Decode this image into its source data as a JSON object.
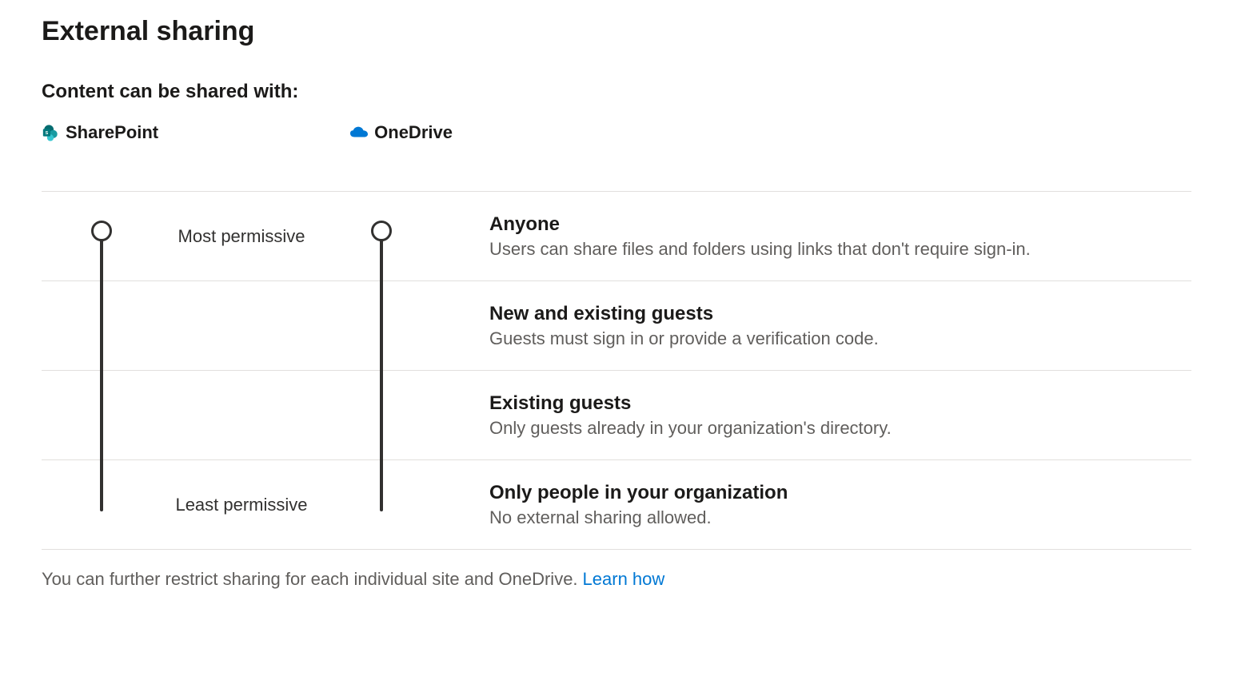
{
  "page": {
    "title": "External sharing",
    "subtitle": "Content can be shared with:"
  },
  "services": [
    {
      "name": "SharePoint",
      "icon": "sharepoint"
    },
    {
      "name": "OneDrive",
      "icon": "onedrive"
    }
  ],
  "slider": {
    "topLabel": "Most permissive",
    "bottomLabel": "Least permissive",
    "levels": [
      {
        "title": "Anyone",
        "description": "Users can share files and folders using links that don't require sign-in."
      },
      {
        "title": "New and existing guests",
        "description": "Guests must sign in or provide a verification code."
      },
      {
        "title": "Existing guests",
        "description": "Only guests already in your organization's directory."
      },
      {
        "title": "Only people in your organization",
        "description": "No external sharing allowed."
      }
    ]
  },
  "footer": {
    "text": "You can further restrict sharing for each individual site and OneDrive.",
    "linkText": "Learn how"
  }
}
